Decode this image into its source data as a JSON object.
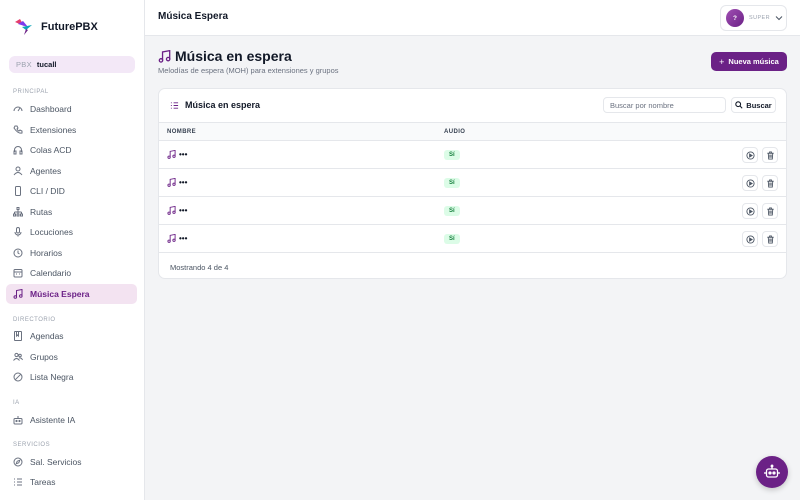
{
  "app": {
    "name": "FuturePBX"
  },
  "pbx": {
    "label": "PBX",
    "value": "tucall"
  },
  "sidebar": {
    "sections": [
      "PRINCIPAL",
      "DIRECTORIO",
      "IA",
      "SERVICIOS"
    ],
    "principal": [
      {
        "label": "Dashboard",
        "icon": "gauge-icon"
      },
      {
        "label": "Extensiones",
        "icon": "phone-icon"
      },
      {
        "label": "Colas ACD",
        "icon": "headset-icon"
      },
      {
        "label": "Agentes",
        "icon": "user-icon"
      },
      {
        "label": "CLI / DID",
        "icon": "mobile-icon"
      },
      {
        "label": "Rutas",
        "icon": "route-icon"
      },
      {
        "label": "Locuciones",
        "icon": "microphone-icon"
      },
      {
        "label": "Horarios",
        "icon": "clock-icon"
      },
      {
        "label": "Calendario",
        "icon": "calendar-icon"
      },
      {
        "label": "Música Espera",
        "icon": "music-note-icon",
        "active": true
      }
    ],
    "directorio": [
      {
        "label": "Agendas",
        "icon": "book-icon"
      },
      {
        "label": "Grupos",
        "icon": "users-icon"
      },
      {
        "label": "Lista Negra",
        "icon": "ban-icon"
      }
    ],
    "ia": [
      {
        "label": "Asistente IA",
        "icon": "robot-icon"
      }
    ],
    "servicios": [
      {
        "label": "Sal. Servicios",
        "icon": "compass-icon"
      },
      {
        "label": "Tareas",
        "icon": "list-icon"
      }
    ]
  },
  "header": {
    "title": "Música Espera",
    "avatar_initial": "?",
    "role": "SUPER"
  },
  "page": {
    "title": "Música en espera",
    "subtitle": "Melodías de espera (MOH) para extensiones y grupos",
    "new_button": "Nueva música"
  },
  "card": {
    "title": "Música en espera",
    "search_placeholder": "Buscar por nombre",
    "search_button": "Buscar",
    "columns": {
      "name": "NOMBRE",
      "audio": "AUDIO"
    },
    "rows": [
      {
        "name": "•••",
        "audio": "Sí"
      },
      {
        "name": "•••",
        "audio": "Sí"
      },
      {
        "name": "•••",
        "audio": "Sí"
      },
      {
        "name": "•••",
        "audio": "Sí"
      }
    ],
    "footer": "Mostrando 4 de 4"
  },
  "colors": {
    "brand": "#6b2186",
    "active_bg": "#f3e3f1",
    "success_bg": "#dcfce7",
    "success_text": "#15803d"
  }
}
